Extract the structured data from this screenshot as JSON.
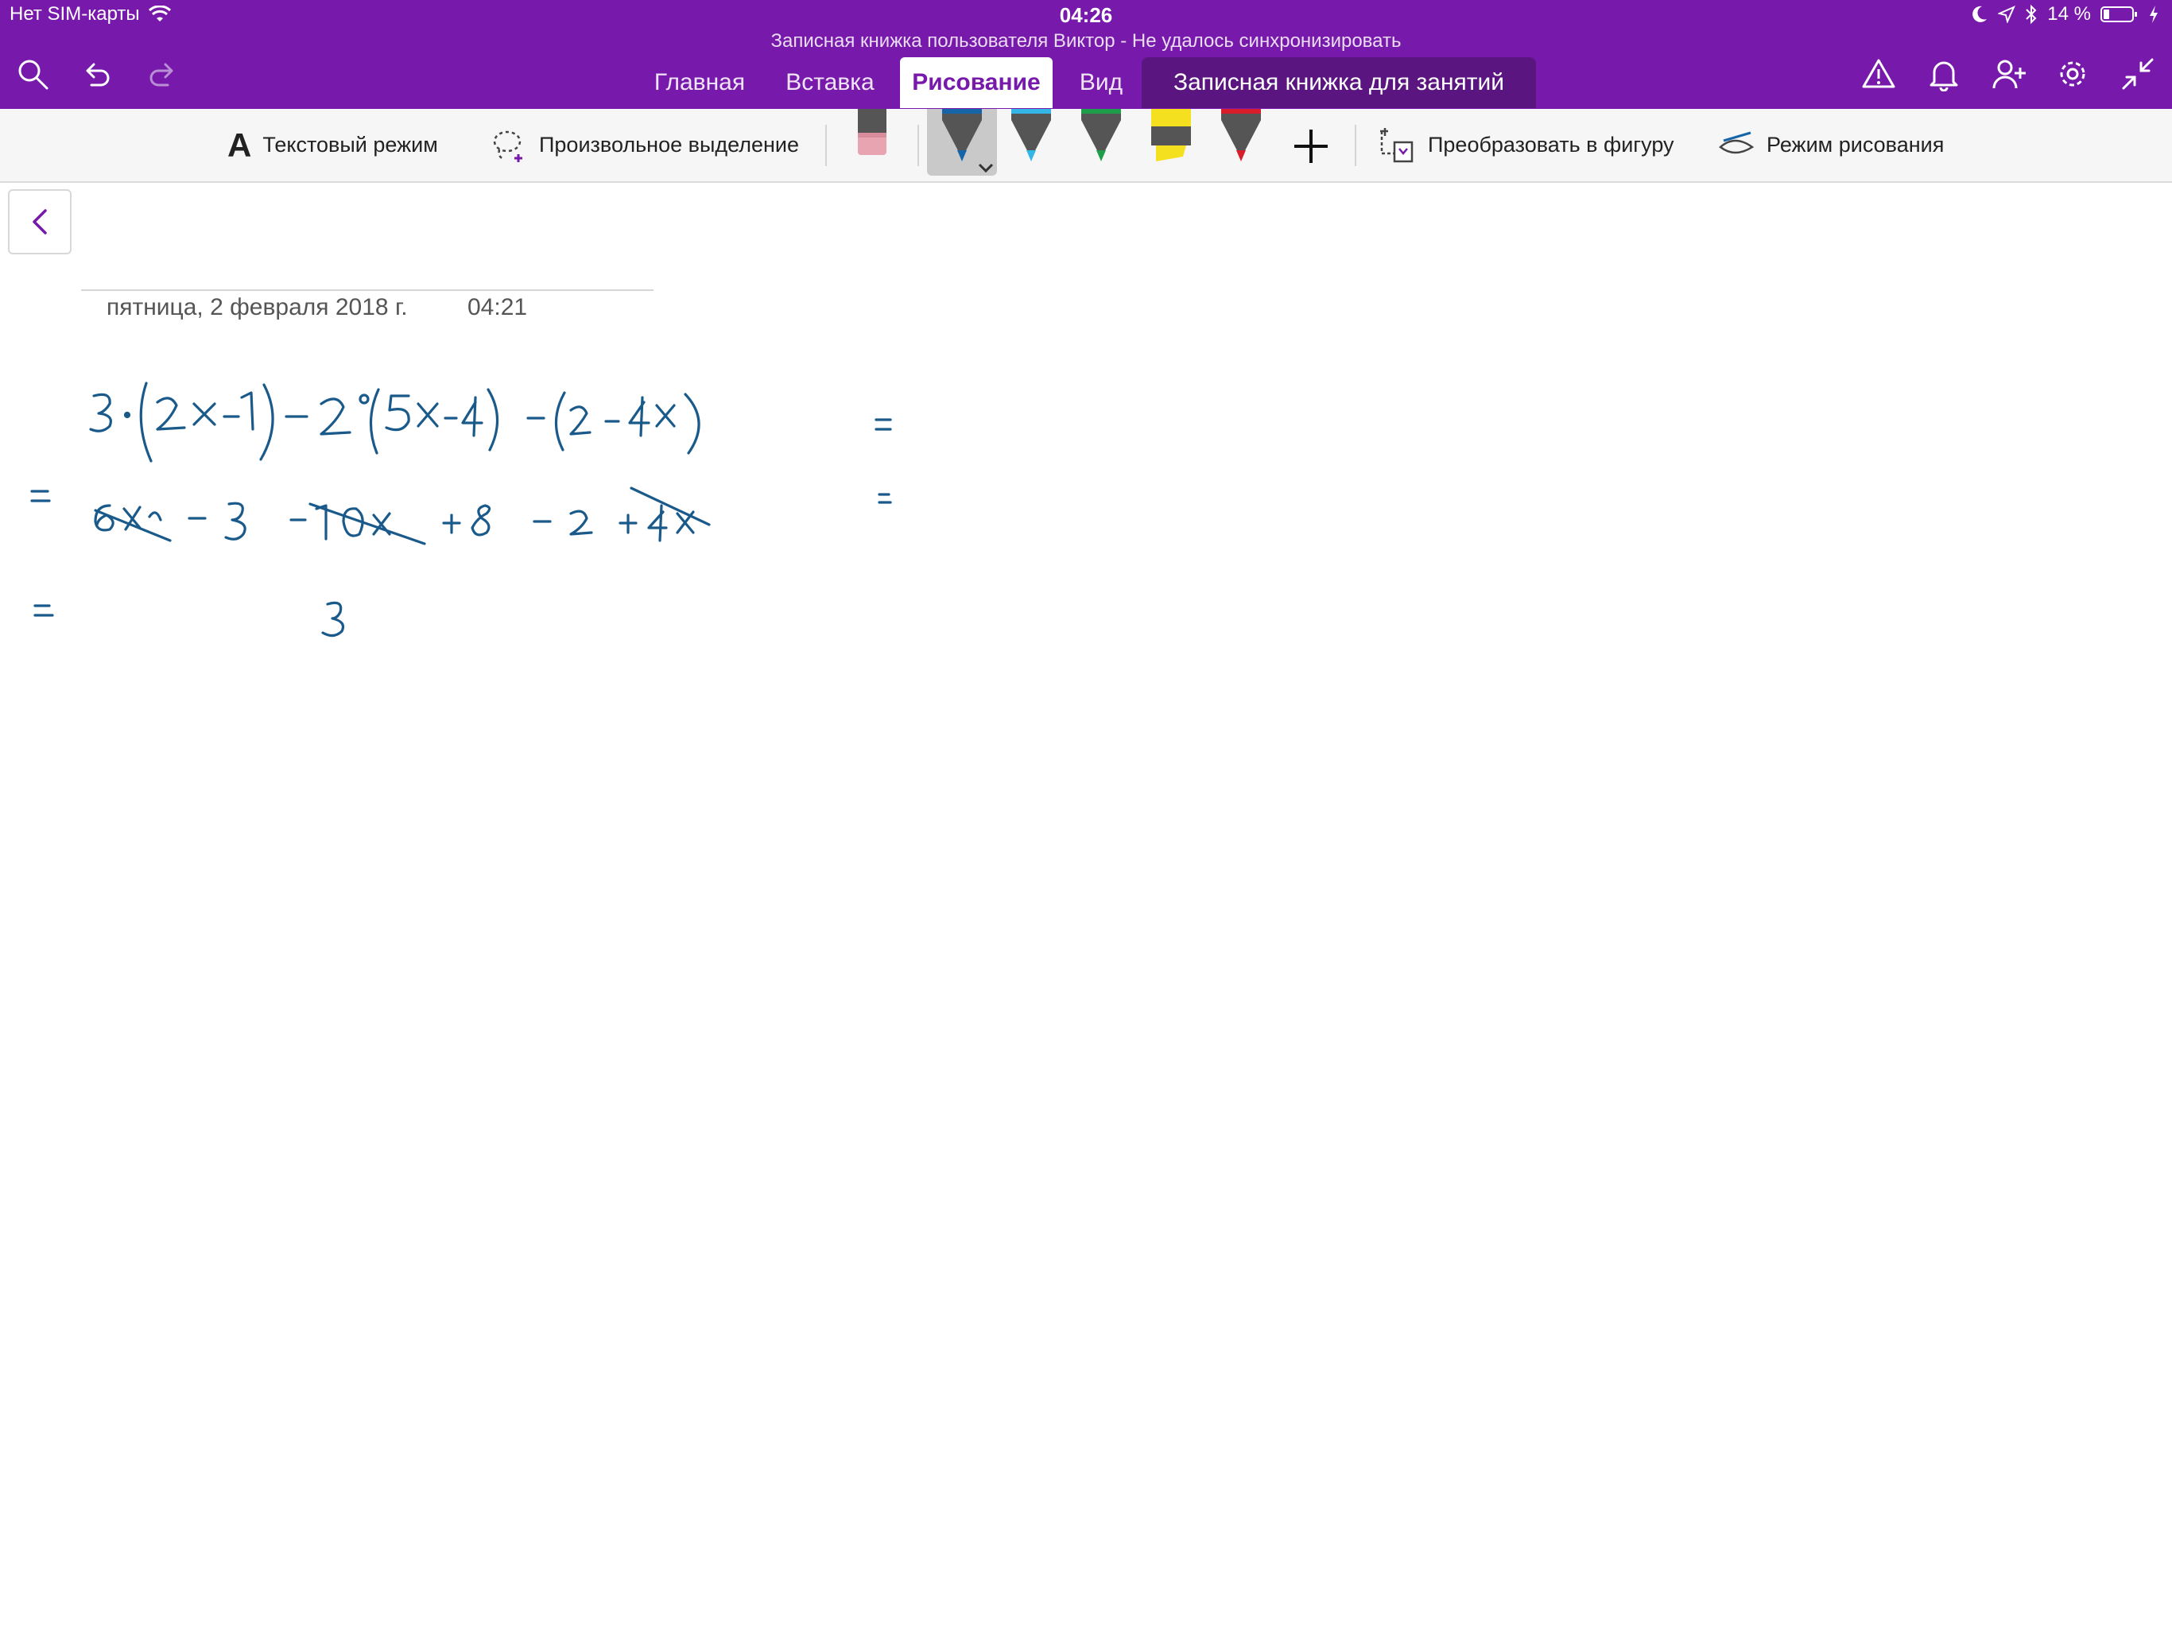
{
  "status_bar": {
    "carrier": "Нет SIM-карты",
    "time": "04:26",
    "battery": "14 %"
  },
  "notebook_title": "Записная книжка пользователя Виктор - Не удалось синхронизировать",
  "tabs": [
    {
      "label": "Главная"
    },
    {
      "label": "Вставка"
    },
    {
      "label": "Рисование",
      "active": true
    },
    {
      "label": "Вид"
    },
    {
      "label": "Записная книжка для занятий"
    }
  ],
  "toolbar": {
    "text_mode": "Текстовый режим",
    "lasso": "Произвольное выделение",
    "convert_shape": "Преобразовать в фигуру",
    "draw_mode": "Режим рисования"
  },
  "pens": [
    {
      "name": "blue-pen",
      "color": "#1565a8"
    },
    {
      "name": "light-blue-pen",
      "color": "#33b5e5"
    },
    {
      "name": "green-pen",
      "color": "#1e9e4a"
    },
    {
      "name": "yellow-highlighter",
      "color": "#f5e020"
    },
    {
      "name": "red-pen",
      "color": "#d81e2a"
    }
  ],
  "page": {
    "date": "пятница, 2 февраля 2018 г.",
    "time": "04:21"
  },
  "colors": {
    "brand": "#7719aa",
    "ink": "#1a5a8a"
  }
}
